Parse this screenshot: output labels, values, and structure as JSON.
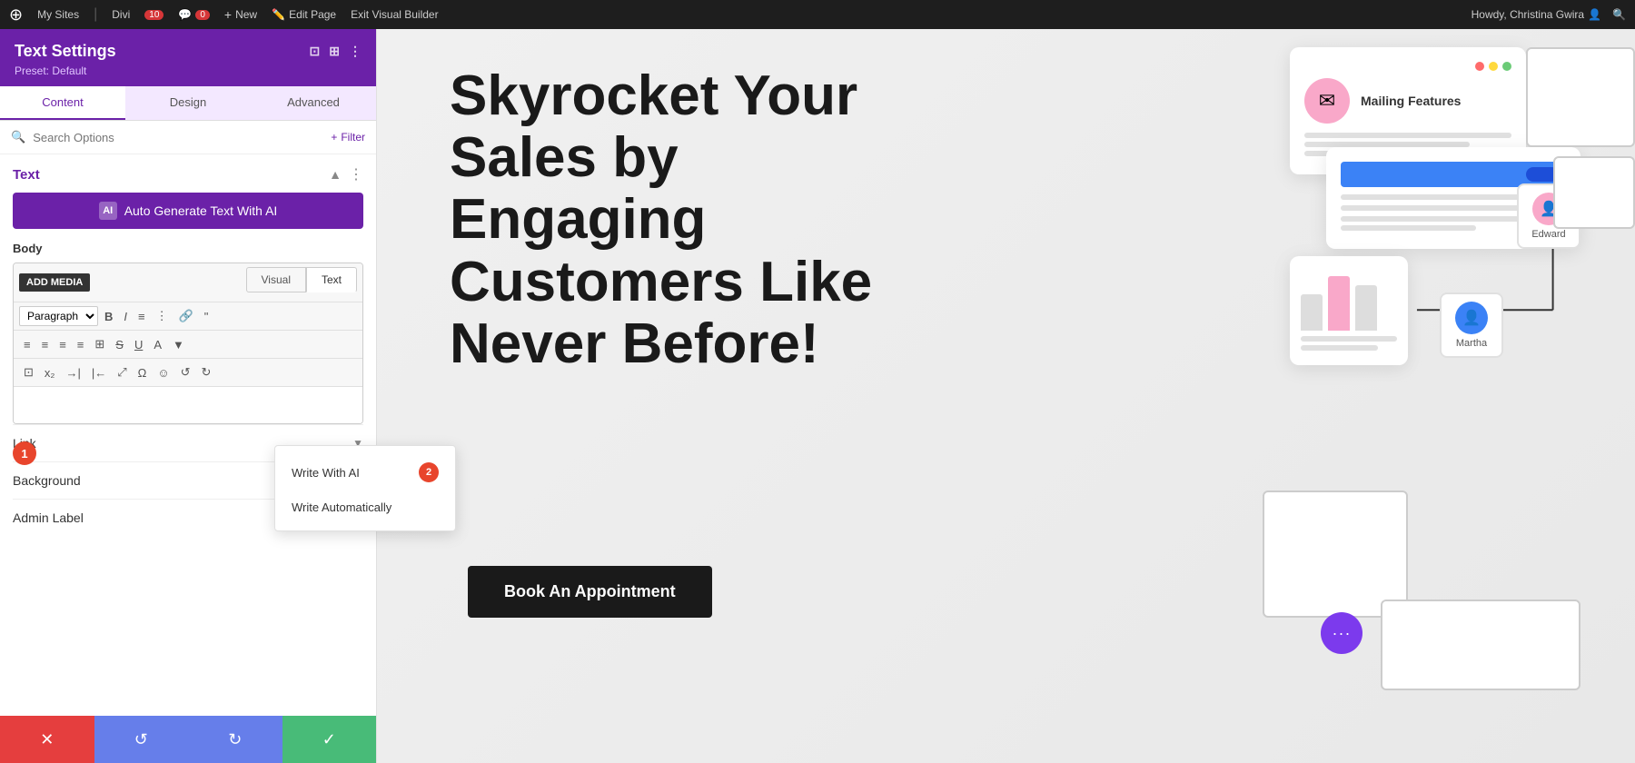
{
  "adminBar": {
    "wpLabel": "W",
    "mySites": "My Sites",
    "divi": "Divi",
    "updates": "10",
    "comments": "0",
    "new": "New",
    "editPage": "Edit Page",
    "exitBuilder": "Exit Visual Builder",
    "userGreeting": "Howdy, Christina Gwira"
  },
  "panel": {
    "title": "Text Settings",
    "preset": "Preset: Default",
    "tabs": [
      "Content",
      "Design",
      "Advanced"
    ],
    "activeTab": "Content",
    "searchPlaceholder": "Search Options",
    "filterLabel": "Filter",
    "sectionTitle": "Text",
    "aiButtonLabel": "Auto Generate Text With AI",
    "bodyLabel": "Body",
    "editorTabs": [
      "Visual",
      "Text"
    ],
    "activeEditorTab": "Text",
    "addMediaLabel": "ADD MEDIA",
    "paragraphOption": "Paragraph",
    "linkLabel": "Link",
    "backgroundLabel": "Background",
    "adminLabelLabel": "Admin Label"
  },
  "aiPopup": {
    "writeWithAI": "Write With AI",
    "writeAutomatically": "Write Automatically",
    "badge": "2"
  },
  "steps": {
    "step1": "1"
  },
  "bottomButtons": {
    "cancel": "✕",
    "undo": "↺",
    "redo": "↻",
    "save": "✓"
  },
  "mainContent": {
    "heading": "Skyrocket Your Sales by Engaging Customers Like Never Before!",
    "bookButton": "Book An Appointment"
  },
  "mockup": {
    "mailingTitle": "Mailing Features",
    "edwardName": "Edward",
    "marthaName": "Martha"
  }
}
